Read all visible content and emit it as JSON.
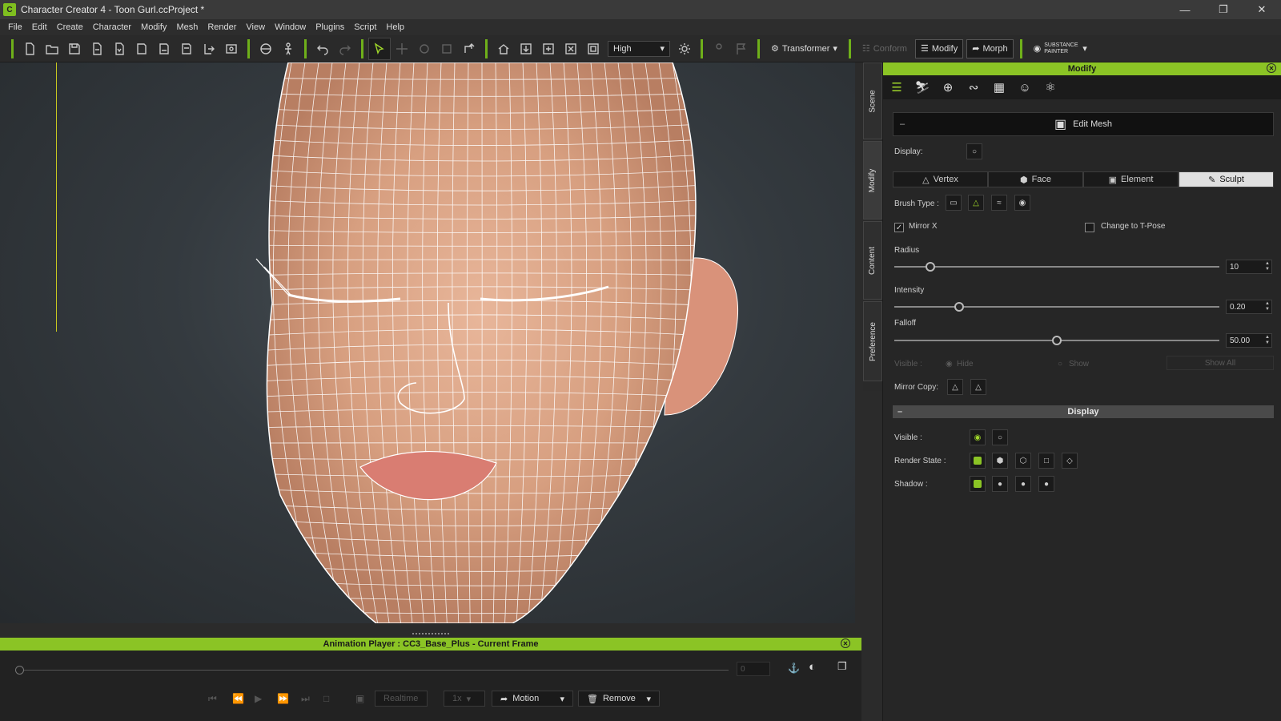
{
  "window": {
    "title": "Character Creator 4 - Toon Gurl.ccProject *",
    "controls": [
      "minimize-icon",
      "restore-icon",
      "close-icon"
    ]
  },
  "menu": [
    "File",
    "Edit",
    "Create",
    "Character",
    "Modify",
    "Mesh",
    "Render",
    "View",
    "Window",
    "Plugins",
    "Script",
    "Help"
  ],
  "toolbar": {
    "quality": "High",
    "transformer_label": "Transformer",
    "conform_label": "Conform",
    "modify_label": "Modify",
    "morph_label": "Morph",
    "substance_label": "SUBSTANCE PAINTER"
  },
  "side_tabs": [
    "Scene",
    "Modify",
    "Content",
    "Preference"
  ],
  "panel": {
    "title": "Modify",
    "edit_mesh_label": "Edit Mesh",
    "display_label": "Display:",
    "mode_tabs": [
      {
        "label": "Vertex",
        "icon": "vertex-icon"
      },
      {
        "label": "Face",
        "icon": "face-icon"
      },
      {
        "label": "Element",
        "icon": "element-icon"
      },
      {
        "label": "Sculpt",
        "icon": "sculpt-brush-icon",
        "active": true
      }
    ],
    "brush_type_label": "Brush Type :",
    "mirror_x_label": "Mirror X",
    "mirror_x_checked": true,
    "change_tpose_label": "Change to T-Pose",
    "change_tpose_checked": false,
    "radius_label": "Radius",
    "radius_value": "10",
    "radius_fraction": 0.11,
    "intensity_label": "Intensity",
    "intensity_value": "0.20",
    "intensity_fraction": 0.2,
    "falloff_label": "Falloff",
    "falloff_value": "50.00",
    "falloff_fraction": 0.5,
    "visible_label": "Visible :",
    "hide_label": "Hide",
    "show_label": "Show",
    "show_all_label": "Show All",
    "mirror_copy_label": "Mirror Copy:",
    "display_section_title": "Display",
    "visible_row_label": "Visible :",
    "render_state_label": "Render State :",
    "shadow_label": "Shadow :"
  },
  "animation_player": {
    "title": "Animation Player : CC3_Base_Plus - Current Frame",
    "frame_value": "0",
    "realtime_label": "Realtime",
    "speed_label": "1x",
    "motion_label": "Motion",
    "remove_label": "Remove"
  },
  "colors": {
    "accent_green": "#8bc425",
    "background": "#262626"
  }
}
